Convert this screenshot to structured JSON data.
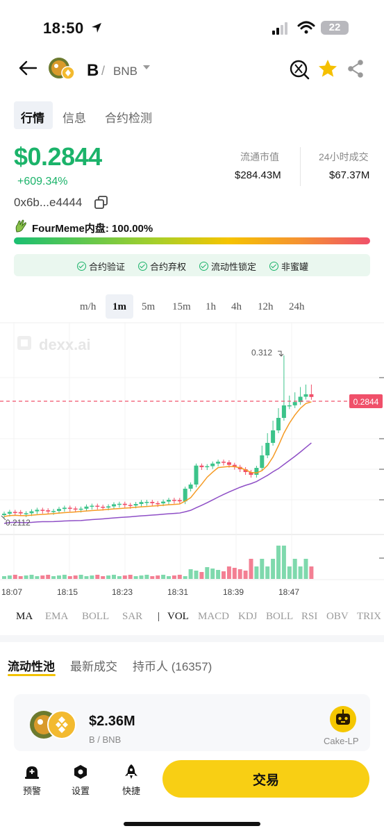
{
  "status_bar": {
    "time": "18:50",
    "battery": "22"
  },
  "header": {
    "token": "B",
    "slash": "/",
    "pair": "BNB"
  },
  "tabs": [
    {
      "label": "行情"
    },
    {
      "label": "信息"
    },
    {
      "label": "合约检测"
    }
  ],
  "price": {
    "value": "$0.2844",
    "change": "+609.34%",
    "contract": "0x6b...e4444"
  },
  "stats": {
    "mcap_label": "流通市值",
    "mcap_value": "$284.43M",
    "vol_label": "24小时成交",
    "vol_value": "$67.37M"
  },
  "fourmeme": {
    "label": "FourMeme内盘: 100.00%",
    "progress": 1.0
  },
  "checks": [
    {
      "label": "合约验证"
    },
    {
      "label": "合约弃权"
    },
    {
      "label": "流动性锁定"
    },
    {
      "label": "非蜜罐"
    }
  ],
  "timeframes": [
    "m/h",
    "1m",
    "5m",
    "15m",
    "1h",
    "4h",
    "12h",
    "24h"
  ],
  "chart": {
    "watermark": "dexx.ai",
    "high_label": "0.312",
    "low_label": "0.2112",
    "current_label": "0.2844",
    "x_ticks": [
      "18:07",
      "18:15",
      "18:23",
      "18:31",
      "18:39",
      "18:47"
    ],
    "colors": {
      "up": "#3cc38a",
      "down": "#f0506a",
      "ma_fast": "#f59a23",
      "ma_slow": "#8e4ec6"
    }
  },
  "indicators": [
    "MA",
    "EMA",
    "BOLL",
    "SAR",
    "|",
    "VOL",
    "MACD",
    "KDJ",
    "BOLL",
    "RSI",
    "OBV",
    "TRIX"
  ],
  "list_tabs": [
    {
      "label": "流动性池"
    },
    {
      "label": "最新成交"
    },
    {
      "label": "持币人 (16357)"
    }
  ],
  "pool": {
    "value": "$2.36M",
    "pair": "B / BNB",
    "dex": "Cake-LP"
  },
  "bottom_nav": [
    {
      "label": "预警",
      "icon": "alarm-icon"
    },
    {
      "label": "设置",
      "icon": "settings-icon"
    },
    {
      "label": "快捷",
      "icon": "rocket-icon"
    }
  ],
  "trade_button": "交易"
}
